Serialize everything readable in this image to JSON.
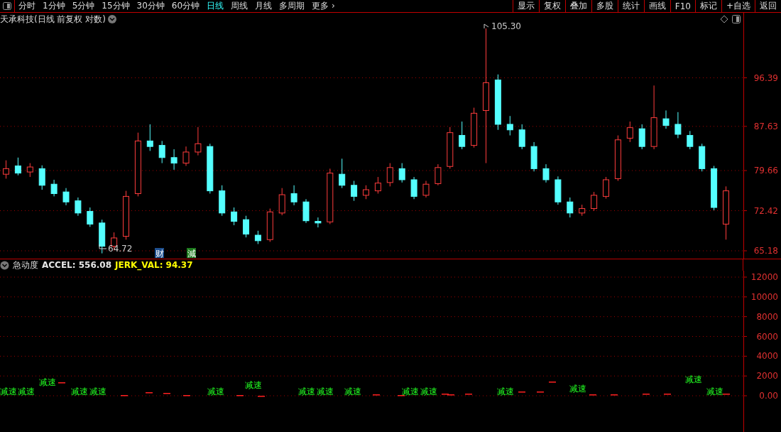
{
  "toolbar": {
    "periods": [
      {
        "label": "分时",
        "selected": false
      },
      {
        "label": "1分钟",
        "selected": false
      },
      {
        "label": "5分钟",
        "selected": false
      },
      {
        "label": "15分钟",
        "selected": false
      },
      {
        "label": "30分钟",
        "selected": false
      },
      {
        "label": "60分钟",
        "selected": false
      },
      {
        "label": "日线",
        "selected": true
      },
      {
        "label": "周线",
        "selected": false
      },
      {
        "label": "月线",
        "selected": false
      },
      {
        "label": "多周期",
        "selected": false
      },
      {
        "label": "更多 ›",
        "selected": false
      }
    ],
    "buttons": [
      "显示",
      "复权",
      "叠加",
      "多股",
      "统计",
      "画线",
      "F10",
      "标记",
      "+自选",
      "返回"
    ]
  },
  "price_panel": {
    "title": "天承科技(日线 前复权 对数)",
    "chart_data": {
      "type": "candlestick",
      "grid": true,
      "ylim": [
        63.77,
        108.12
      ],
      "yticks": [
        {
          "value": 96.39,
          "label": "96.39"
        },
        {
          "value": 87.63,
          "label": "87.63"
        },
        {
          "value": 79.66,
          "label": "79.66"
        },
        {
          "value": 72.42,
          "label": "72.42"
        },
        {
          "value": 65.18,
          "label": "65.18"
        }
      ],
      "ohlc": [
        [
          79.0,
          81.5,
          78.2,
          80.0
        ],
        [
          80.5,
          82.0,
          78.8,
          79.2
        ],
        [
          79.4,
          81.0,
          78.5,
          80.3
        ],
        [
          80.0,
          80.6,
          76.2,
          77.0
        ],
        [
          77.2,
          78.0,
          75.0,
          75.5
        ],
        [
          75.8,
          76.5,
          73.4,
          74.0
        ],
        [
          74.2,
          74.8,
          71.5,
          72.0
        ],
        [
          72.3,
          73.0,
          69.5,
          70.0
        ],
        [
          70.2,
          70.8,
          64.72,
          66.0
        ],
        [
          66.0,
          68.5,
          65.4,
          67.5
        ],
        [
          67.8,
          76.0,
          67.2,
          75.0
        ],
        [
          75.5,
          86.5,
          75.0,
          85.0
        ],
        [
          85.0,
          88.0,
          83.2,
          84.0
        ],
        [
          84.2,
          85.0,
          81.0,
          82.0
        ],
        [
          82.0,
          83.5,
          79.8,
          81.0
        ],
        [
          81.0,
          84.0,
          80.5,
          83.0
        ],
        [
          83.0,
          87.5,
          82.4,
          84.5
        ],
        [
          84.0,
          84.5,
          75.5,
          76.0
        ],
        [
          76.0,
          77.0,
          71.5,
          72.0
        ],
        [
          72.2,
          73.0,
          69.8,
          70.5
        ],
        [
          70.8,
          71.5,
          67.6,
          68.2
        ],
        [
          68.0,
          68.8,
          66.4,
          67.0
        ],
        [
          67.2,
          72.8,
          66.8,
          72.2
        ],
        [
          72.0,
          76.5,
          71.6,
          75.3
        ],
        [
          75.5,
          77.0,
          73.4,
          74.0
        ],
        [
          74.0,
          74.5,
          70.2,
          70.6
        ],
        [
          70.5,
          71.2,
          69.4,
          70.2
        ],
        [
          70.4,
          80.0,
          70.0,
          79.2
        ],
        [
          79.0,
          81.8,
          76.5,
          77.0
        ],
        [
          77.0,
          77.8,
          74.2,
          75.0
        ],
        [
          75.2,
          77.0,
          74.5,
          76.2
        ],
        [
          76.0,
          78.5,
          75.5,
          77.4
        ],
        [
          77.5,
          81.0,
          76.8,
          80.2
        ],
        [
          80.0,
          81.0,
          77.5,
          78.0
        ],
        [
          78.0,
          78.5,
          74.5,
          75.0
        ],
        [
          75.2,
          77.8,
          74.8,
          77.2
        ],
        [
          77.3,
          80.8,
          77.0,
          80.2
        ],
        [
          80.4,
          87.5,
          80.0,
          86.5
        ],
        [
          86.0,
          88.5,
          83.5,
          84.0
        ],
        [
          84.2,
          91.0,
          83.8,
          90.0
        ],
        [
          90.5,
          105.3,
          81.0,
          95.5
        ],
        [
          96.0,
          97.0,
          87.0,
          88.0
        ],
        [
          88.0,
          89.5,
          86.0,
          87.0
        ],
        [
          87.0,
          88.0,
          83.5,
          84.0
        ],
        [
          84.0,
          84.8,
          79.5,
          80.0
        ],
        [
          80.0,
          80.8,
          77.5,
          78.0
        ],
        [
          78.0,
          78.6,
          73.5,
          74.0
        ],
        [
          74.0,
          74.8,
          71.2,
          72.0
        ],
        [
          72.0,
          73.5,
          71.5,
          72.8
        ],
        [
          72.8,
          75.8,
          72.4,
          75.2
        ],
        [
          75.0,
          78.5,
          74.6,
          78.0
        ],
        [
          78.2,
          86.0,
          77.8,
          85.2
        ],
        [
          85.5,
          88.5,
          84.8,
          87.4
        ],
        [
          87.2,
          88.0,
          83.5,
          84.0
        ],
        [
          84.0,
          95.0,
          83.5,
          89.2
        ],
        [
          89.0,
          90.5,
          87.2,
          87.8
        ],
        [
          88.0,
          90.2,
          85.5,
          86.2
        ],
        [
          86.0,
          86.8,
          83.5,
          84.0
        ],
        [
          84.0,
          84.5,
          79.5,
          80.0
        ],
        [
          80.0,
          80.5,
          72.5,
          73.0
        ],
        [
          70.0,
          76.8,
          67.2,
          76.0
        ]
      ]
    },
    "high_label": "105.30",
    "low_label": "64.72",
    "events": [
      {
        "label": "财",
        "color": "#1e4f8f"
      },
      {
        "label": "減",
        "color": "#1d7a1d"
      }
    ]
  },
  "indicator_panel": {
    "name": "急动度",
    "values": [
      {
        "label": "ACCEL: 556.08",
        "color": "#e6e6e6"
      },
      {
        "label": "JERK_VAL: 94.37",
        "color": "#ffff00"
      }
    ],
    "y_axis": [
      "12000",
      "10000",
      "8000",
      "6000",
      "4000",
      "2000",
      "0.00"
    ],
    "signals": [
      "减速",
      "减速",
      "减速",
      "减速",
      "减速",
      "减速",
      "减速",
      "减速",
      "减速",
      "减速",
      "减速",
      "减速",
      "减速",
      "减速",
      "减速",
      "减速"
    ]
  }
}
